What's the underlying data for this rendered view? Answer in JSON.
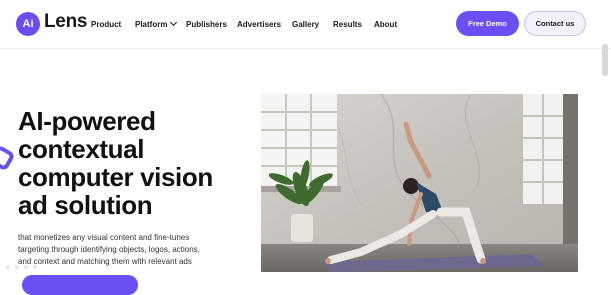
{
  "header": {
    "logo_badge": "Ai",
    "logo_word": "Lens",
    "nav": [
      {
        "label": "Product"
      },
      {
        "label": "Platform",
        "has_dropdown": true
      },
      {
        "label": "Publishers"
      },
      {
        "label": "Advertisers"
      },
      {
        "label": "Gallery"
      },
      {
        "label": "Results"
      },
      {
        "label": "About"
      }
    ],
    "free_demo": "Free Demo",
    "contact": "Contact us"
  },
  "hero": {
    "headline": [
      "AI-powered",
      "contextual",
      "computer vision",
      "ad solution"
    ],
    "description": [
      "that monetizes any visual content and fine-tunes",
      "targeting through identifying objects, logos, actions,",
      "and context and matching them with relevant ads"
    ]
  },
  "colors": {
    "brand": "#6b4ff2",
    "contact_bg": "#f3f1fb",
    "text": "#111111"
  }
}
